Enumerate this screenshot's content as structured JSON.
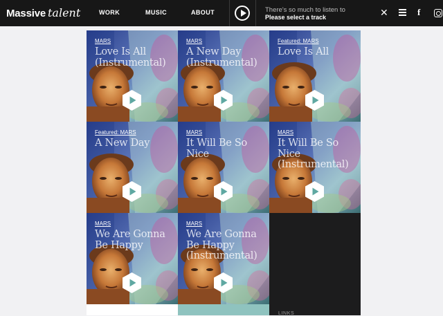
{
  "header": {
    "logo_part1": "Massive",
    "logo_part2": "talent",
    "nav": [
      "WORK",
      "MUSIC",
      "ABOUT"
    ],
    "now_playing_line1": "There's so much to listen to",
    "now_playing_line2": "Please select a track"
  },
  "tiles": [
    {
      "tag": "MARS",
      "title": "Love Is All (Instrumental)"
    },
    {
      "tag": "MARS",
      "title": "A New Day (Instrumental)"
    },
    {
      "tag": "Featured: MARS",
      "title": "Love Is All"
    },
    {
      "tag": "Featured: MARS",
      "title": "A New Day"
    },
    {
      "tag": "MARS",
      "title": "It Will Be So Nice"
    },
    {
      "tag": "MARS",
      "title": "It Will Be So Nice (Instrumental)"
    },
    {
      "tag": "MARS",
      "title": "We Are Gonna Be Happy"
    },
    {
      "tag": "MARS",
      "title": "We Are Gonna Be Happy (Instrumental)"
    }
  ],
  "footer": {
    "links_label": "LINKS"
  },
  "colors": {
    "header_bg": "#171717",
    "tile_teal": "#8fc3bf",
    "dark_panel": "#1c1c1d"
  },
  "icons": [
    "play-icon",
    "close-icon",
    "playlist-icon",
    "facebook-icon",
    "instagram-icon"
  ]
}
